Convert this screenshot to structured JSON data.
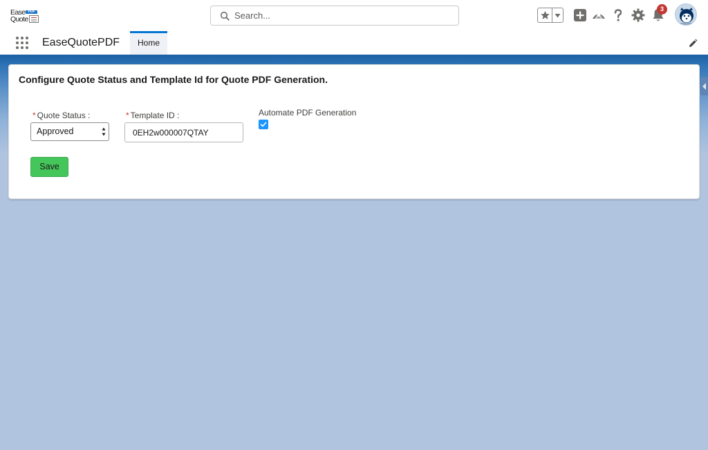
{
  "header": {
    "logo": {
      "line1": "Ease",
      "line2": "Quote",
      "badge": "PDF"
    },
    "search": {
      "placeholder": "Search..."
    },
    "icons": [
      "star-icon",
      "chevron-down-icon",
      "add-icon",
      "trailhead-icon",
      "help-icon",
      "gear-icon",
      "bell-icon",
      "avatar"
    ],
    "notification_count": "3"
  },
  "nav": {
    "app_name": "EaseQuotePDF",
    "tabs": [
      {
        "label": "Home",
        "active": true
      }
    ]
  },
  "card": {
    "title": "Configure Quote Status and Template Id for Quote PDF Generation.",
    "quote_status": {
      "label": "Quote Status :",
      "required": "*",
      "value": "Approved"
    },
    "template_id": {
      "label": "Template ID :",
      "required": "*",
      "value": "0EH2w000007QTAY"
    },
    "automate": {
      "label": "Automate PDF Generation",
      "checked": true
    },
    "save_label": "Save"
  },
  "colors": {
    "brand_blue": "#0176d3",
    "save_green": "#45c65a",
    "checkbox_blue": "#1b96ff",
    "required_red": "#c23934",
    "background": "#b0c4df"
  }
}
